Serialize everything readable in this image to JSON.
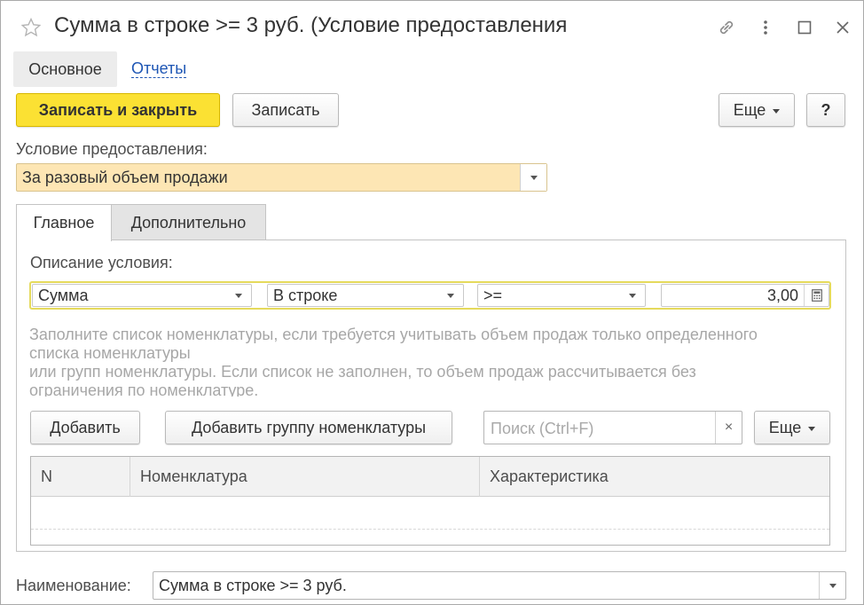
{
  "window": {
    "title": "Сумма в строке >= 3 руб. (Условие предоставления",
    "icons": [
      "star-icon",
      "link-icon",
      "more-vertical-icon",
      "maximize-icon",
      "close-icon"
    ]
  },
  "sections": {
    "main": "Основное",
    "reports": "Отчеты"
  },
  "toolbar": {
    "save_close": "Записать и закрыть",
    "save": "Записать",
    "more": "Еще",
    "help": "?"
  },
  "condition": {
    "label": "Условие предоставления:",
    "value": "За разовый объем продажи"
  },
  "tabs": {
    "main": "Главное",
    "extra": "Дополнительно"
  },
  "description": {
    "label": "Описание условия:",
    "field1": "Сумма",
    "field2": "В строке",
    "field3": ">=",
    "amount": "3,00"
  },
  "hint": {
    "line1": "Заполните список номенклатуры, если требуется учитывать объем продаж только определенного",
    "line2": "списка номенклатуры",
    "line3": "или групп номенклатуры. Если список не заполнен, то объем продаж рассчитывается без",
    "line4": "ограничения по номенклатуре."
  },
  "list_toolbar": {
    "add": "Добавить",
    "add_group": "Добавить группу номенклатуры",
    "search_placeholder": "Поиск (Ctrl+F)",
    "clear": "×",
    "more": "Еще"
  },
  "table": {
    "columns": [
      "N",
      "Номенклатура",
      "Характеристика"
    ]
  },
  "name": {
    "label": "Наименование:",
    "value": "Сумма в строке >= 3 руб."
  },
  "colors": {
    "primary_button": "#fbe133",
    "condition_field_bg": "#fde6b4",
    "link": "#1e56b4",
    "focus_border": "#e5da5c"
  }
}
